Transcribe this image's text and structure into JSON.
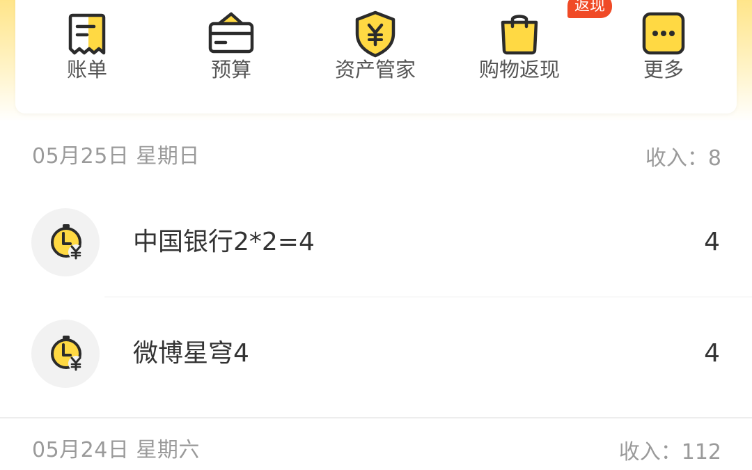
{
  "shortcuts": [
    {
      "label": "账单",
      "icon": "bill-icon"
    },
    {
      "label": "预算",
      "icon": "wallet-icon"
    },
    {
      "label": "资产管家",
      "icon": "shield-yen-icon"
    },
    {
      "label": "购物返现",
      "icon": "shopping-bag-icon",
      "badge": "返现"
    },
    {
      "label": "更多",
      "icon": "more-icon"
    }
  ],
  "days": [
    {
      "date": "05月25日 星期日",
      "income": "收入：8",
      "records": [
        {
          "name": "中国银行2*2=4",
          "amount": "4",
          "icon": "clock-yen-icon"
        },
        {
          "name": "微博星穹4",
          "amount": "4",
          "icon": "clock-yen-icon"
        }
      ]
    },
    {
      "date": "05月24日 星期六",
      "income": "收入：112"
    }
  ],
  "colors": {
    "accent_yellow": "#FFD943",
    "badge_red": "#F04A26",
    "icon_stroke": "#2B2B2B",
    "text_primary": "#333333",
    "text_secondary": "#9A9A9A"
  }
}
